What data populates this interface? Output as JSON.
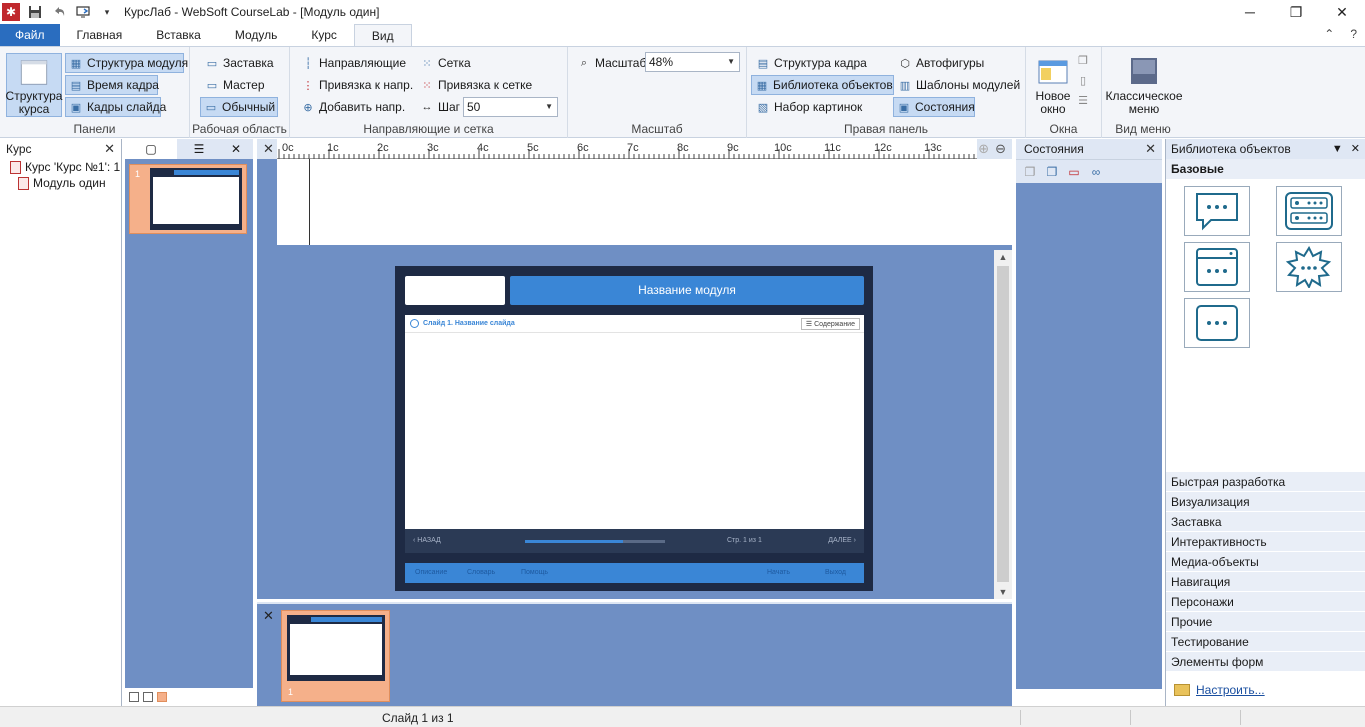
{
  "window": {
    "title": "КурсЛаб - WebSoft CourseLab - [Модуль один]",
    "app_icon": "courselab-logo-icon",
    "controls": [
      "minimize-icon",
      "restore-icon",
      "close-icon"
    ]
  },
  "quick_access": [
    "save-icon",
    "undo-icon",
    "publish-icon",
    "customize-arrow-icon"
  ],
  "tabs": [
    {
      "label": "Файл"
    },
    {
      "label": "Главная"
    },
    {
      "label": "Вставка"
    },
    {
      "label": "Модуль"
    },
    {
      "label": "Курс"
    },
    {
      "label": "Вид"
    }
  ],
  "active_tab": "Вид",
  "ribbon": {
    "panels": {
      "label": "Панели",
      "big_button": "Структура курса",
      "items": [
        "Структура модуля",
        "Время кадра",
        "Кадры слайда"
      ]
    },
    "workarea": {
      "label": "Рабочая область",
      "items": [
        "Заставка",
        "Мастер",
        "Обычный"
      ]
    },
    "guides": {
      "label": "Направляющие и сетка",
      "items": [
        "Направляющие",
        "Привязка к напр.",
        "Добавить напр."
      ],
      "grid_items": [
        "Сетка",
        "Привязка к сетке"
      ],
      "step_label": "Шаг",
      "step_value": "50"
    },
    "scale": {
      "label": "Масштаб",
      "button": "Масштаб",
      "value": "48%"
    },
    "right_panel": {
      "label": "Правая панель",
      "items": [
        "Структура кадра",
        "Библиотека объектов",
        "Набор картинок"
      ],
      "items2": [
        "Автофигуры",
        "Шаблоны модулей",
        "Состояния"
      ]
    },
    "windows": {
      "label": "Окна",
      "big_button": "Новое окно"
    },
    "menu_view": {
      "label": "Вид меню",
      "big_button": "Классическое меню"
    }
  },
  "course_panel": {
    "title": "Курс",
    "tree": [
      "Курс 'Курс №1': 1",
      "Модуль один"
    ]
  },
  "slides_panel": {
    "slide_number": "1"
  },
  "ruler": {
    "ticks": [
      "0c",
      "1c",
      "2c",
      "3c",
      "4c",
      "5c",
      "6c",
      "7c",
      "8c",
      "9c",
      "10c",
      "11c",
      "12c",
      "13c"
    ]
  },
  "slide": {
    "module_title": "Название модуля",
    "content_title": "Слайд 1. Название слайда",
    "toc_label": "Содержание",
    "prev_label": "НАЗАД",
    "next_label": "ДАЛЕЕ",
    "page_info": "Стр. 1 из 1",
    "progress_fraction": 0.7,
    "footer_items": [
      "Описание",
      "Словарь",
      "Помощь",
      "Начать",
      "Выход"
    ]
  },
  "filmstrip": {
    "frame_number": "1"
  },
  "states_panel": {
    "title": "Состояния"
  },
  "object_library": {
    "title": "Библиотека объектов",
    "category_open": "Базовые",
    "categories": [
      "Быстрая разработка",
      "Визуализация",
      "Заставка",
      "Интерактивность",
      "Медиа-объекты",
      "Навигация",
      "Персонажи",
      "Прочие",
      "Тестирование",
      "Элементы форм"
    ],
    "customize_label": "Настроить...",
    "tiles": [
      "speech-bubble-icon",
      "list-panel-icon",
      "window-panel-icon",
      "burst-shape-icon",
      "text-box-icon"
    ]
  },
  "status": {
    "text": "Слайд 1 из 1"
  },
  "colors": {
    "accent": "#2a6dbf",
    "panel_bg": "#6f8fc4",
    "slide_dark": "#1e2a44",
    "slide_blue": "#3a86d6",
    "thumb_selected": "#f5b08a"
  }
}
